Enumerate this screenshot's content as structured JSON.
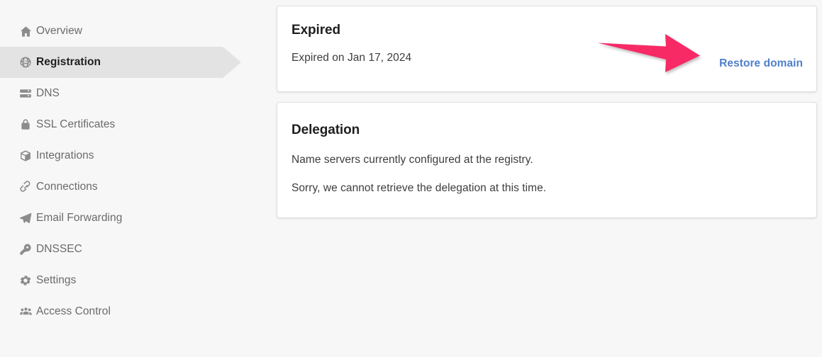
{
  "theme": {
    "page_background": "#f7f7f7",
    "card_background": "#ffffff",
    "active_nav_background": "#e3e3e3",
    "link_color": "#4f80cc",
    "annotation_arrow_color": "#f72a66",
    "icon_color": "#8c8c8c",
    "text_color": "#3d3d3d",
    "heading_color": "#1f1f1f"
  },
  "sidebar": {
    "items": [
      {
        "label": "Overview",
        "icon": "home-icon",
        "active": false
      },
      {
        "label": "Registration",
        "icon": "globe-icon",
        "active": true
      },
      {
        "label": "DNS",
        "icon": "server-icon",
        "active": false
      },
      {
        "label": "SSL Certificates",
        "icon": "lock-icon",
        "active": false
      },
      {
        "label": "Integrations",
        "icon": "box-icon",
        "active": false
      },
      {
        "label": "Connections",
        "icon": "link-icon",
        "active": false
      },
      {
        "label": "Email Forwarding",
        "icon": "paper-plane-icon",
        "active": false
      },
      {
        "label": "DNSSEC",
        "icon": "key-icon",
        "active": false
      },
      {
        "label": "Settings",
        "icon": "gear-icon",
        "active": false
      },
      {
        "label": "Access Control",
        "icon": "users-icon",
        "active": false
      }
    ]
  },
  "main": {
    "expired_card": {
      "title": "Expired",
      "detail": "Expired on Jan 17, 2024",
      "action_label": "Restore domain"
    },
    "delegation_card": {
      "title": "Delegation",
      "line1": "Name servers currently configured at the registry.",
      "line2": "Sorry, we cannot retrieve the delegation at this time."
    }
  },
  "annotation": {
    "arrow": "right-arrow-annotation",
    "points_to": "Restore domain"
  }
}
